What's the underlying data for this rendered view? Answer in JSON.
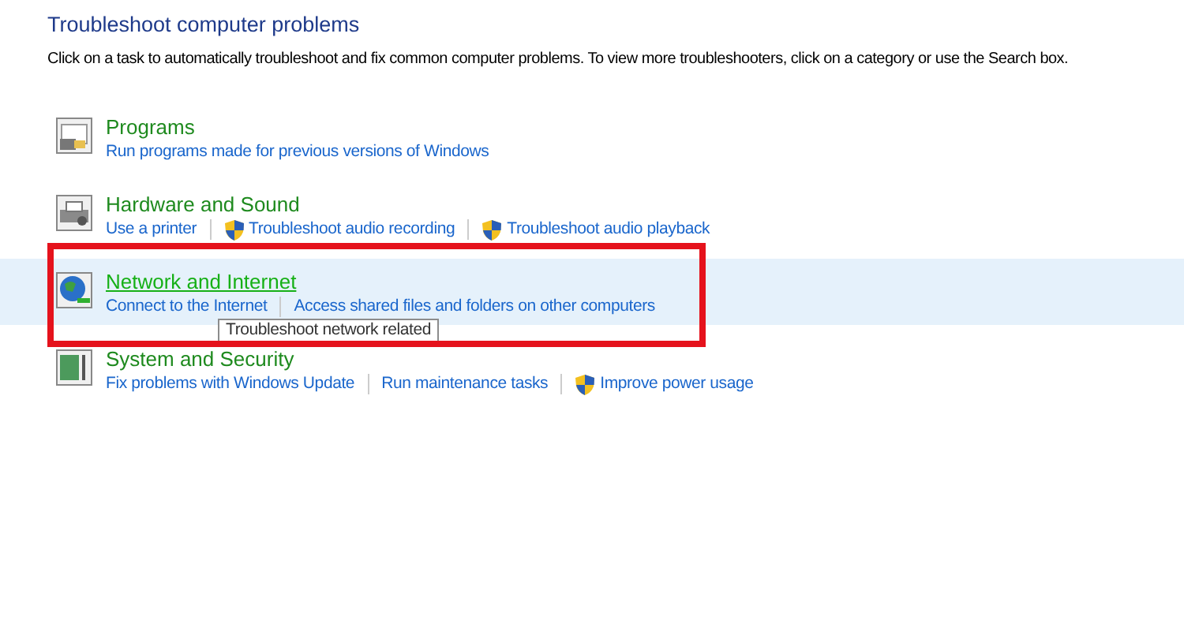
{
  "title": "Troubleshoot computer problems",
  "description": "Click on a task to automatically troubleshoot and fix common computer problems. To view more troubleshooters, click on a category or use the Search box.",
  "categories": [
    {
      "name": "Programs",
      "kind": "programs",
      "hovered": false,
      "links": [
        {
          "label": "Run programs made for previous versions of Windows",
          "shield": false
        }
      ]
    },
    {
      "name": "Hardware and Sound",
      "kind": "hardware",
      "hovered": false,
      "links": [
        {
          "label": "Use a printer",
          "shield": false
        },
        {
          "label": "Troubleshoot audio recording",
          "shield": true
        },
        {
          "label": "Troubleshoot audio playback",
          "shield": true
        }
      ]
    },
    {
      "name": "Network and Internet",
      "kind": "network",
      "hovered": true,
      "links": [
        {
          "label": "Connect to the Internet",
          "shield": false
        },
        {
          "label": "Access shared files and folders on other computers",
          "shield": false
        }
      ]
    },
    {
      "name": "System and Security",
      "kind": "system",
      "hovered": false,
      "links": [
        {
          "label": "Fix problems with Windows Update",
          "shield": false
        },
        {
          "label": "Run maintenance tasks",
          "shield": false
        },
        {
          "label": "Improve power usage",
          "shield": true
        }
      ]
    }
  ],
  "tooltip": {
    "text": "Troubleshoot network related"
  }
}
